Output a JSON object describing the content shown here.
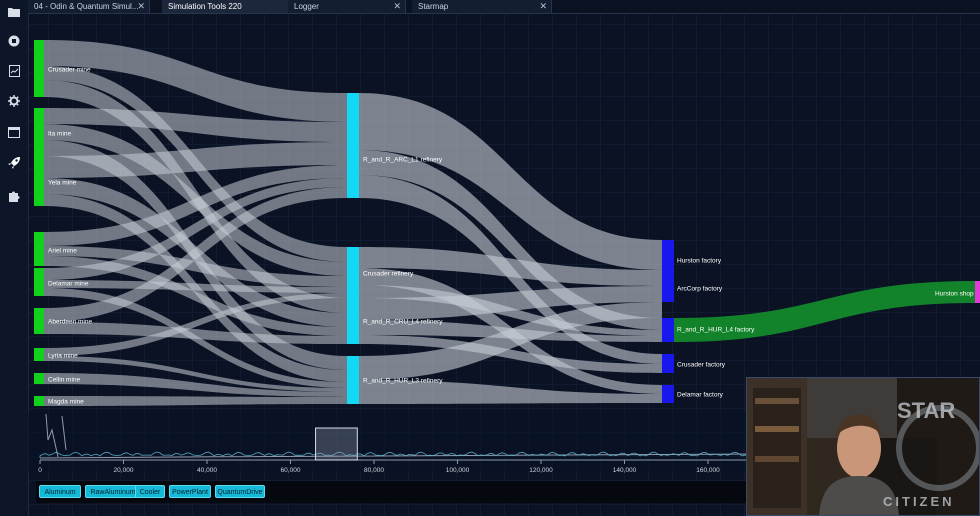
{
  "tabs": [
    {
      "label": "04 - Odin & Quantum Simul..."
    },
    {
      "label": "Simulation Tools 220"
    },
    {
      "label": "Logger"
    },
    {
      "label": "Starmap"
    }
  ],
  "sidebar_icons": [
    "folder-icon",
    "record-icon",
    "report-icon",
    "settings-icon",
    "window-icon",
    "rocket-icon",
    "puzzle-icon"
  ],
  "chart_data": {
    "type": "sankey",
    "nodes": {
      "sources": [
        "Crusader mine",
        "Ita mine",
        "Yela mine",
        "Ariel mine",
        "Delamar mine",
        "Aberdeen mine",
        "Lyria mine",
        "Cellin mine",
        "Magda mine"
      ],
      "refineries": [
        "R_and_R_ARC_L1 refinery",
        "Crusader refinery",
        "R_and_R_CRU_L4 refinery",
        "R_and_R_HUR_L3 refinery"
      ],
      "factories": [
        "Hurston factory",
        "ArcCorp factory",
        "R_and_R_HUR_L4 factory",
        "Crusader factory",
        "Delamar factory"
      ],
      "shops": [
        "Hurston shop"
      ]
    },
    "colors": {
      "mine": "#11d11c",
      "refinery": "#13d8f5",
      "factory": "#1717ee",
      "shop": "#e43ad8",
      "link": "#c8cdd6",
      "product_link": "#148a2c"
    },
    "timeline": {
      "x_ticks": [
        "0",
        "20,000",
        "40,000",
        "60,000",
        "80,000",
        "100,000",
        "120,000",
        "140,000",
        "160,000"
      ],
      "xlim": [
        0,
        170000
      ],
      "brush_range": [
        66000,
        76000
      ]
    }
  },
  "filter_chips": [
    "Aluminum",
    "RawAluminum",
    "Cooler",
    "PowerPlant",
    "QuantumDrive"
  ],
  "overlay": {
    "brand_line1": "STAR",
    "brand_line2": "CITIZEN"
  }
}
